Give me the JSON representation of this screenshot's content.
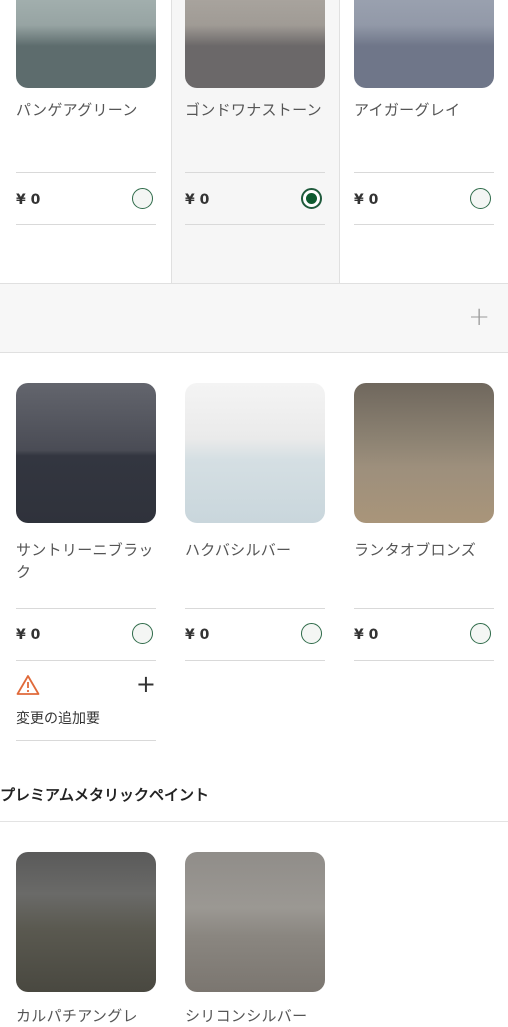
{
  "row1": [
    {
      "name": "パンゲアグリーン",
      "price": "¥ 0",
      "selected": false,
      "swatch": {
        "top": "#b7c4c2",
        "bottom": "#5d6c6d"
      }
    },
    {
      "name": "ゴンドワナストーン",
      "price": "¥ 0",
      "selected": true,
      "swatch": {
        "top": "#b8b4ae",
        "bottom": "#6b6869"
      }
    },
    {
      "name": "アイガーグレイ",
      "price": "¥ 0",
      "selected": false,
      "swatch": {
        "top": "#a9b0bd",
        "bottom": "#6f7689"
      }
    }
  ],
  "expander": {
    "icon": "plus-icon",
    "label": "+"
  },
  "row2": [
    {
      "name": "サントリーニブラック",
      "price": "¥ 0",
      "selected": false,
      "swatch": {
        "top": "#63656d",
        "bottom": "#2f323b"
      }
    },
    {
      "name": "ハクバシルバー",
      "price": "¥ 0",
      "selected": false,
      "swatch": {
        "top": "#f4f4f4",
        "bottom": "#c9d6dc"
      }
    },
    {
      "name": "ランタオブロンズ",
      "price": "¥ 0",
      "selected": false,
      "swatch": {
        "top": "#7a7164",
        "bottom": "#a9957a"
      }
    }
  ],
  "warning": {
    "icon": "warning-icon",
    "text": "変更の追加要",
    "plus": "+"
  },
  "section": {
    "title": "プレミアムメタリックペイント"
  },
  "row3": [
    {
      "name": "カルパチアングレ",
      "swatch": {
        "top": "#5d5d5d",
        "bottom": "#494840"
      }
    },
    {
      "name": "シリコンシルバー",
      "swatch": {
        "top": "#8d8a86",
        "bottom": "#7b7670"
      }
    }
  ],
  "colors": {
    "accent": "#0e5a2f",
    "warning": "#e06a3a"
  }
}
